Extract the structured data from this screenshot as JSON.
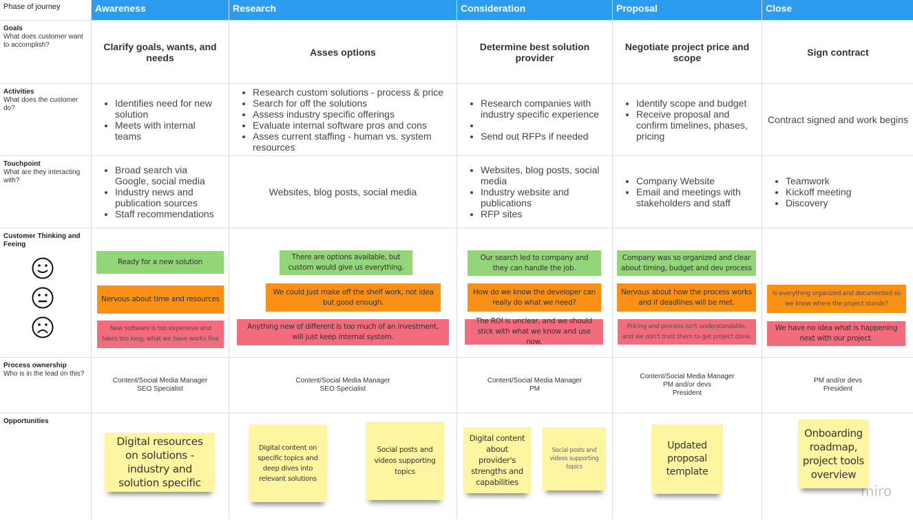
{
  "row_labels": [
    {
      "title": "Phase of journey",
      "subtitle": ""
    },
    {
      "title": "Goals",
      "subtitle": "What does customer want to accomplish?"
    },
    {
      "title": "Activities",
      "subtitle": "What does the customer do?"
    },
    {
      "title": "Touchpoint",
      "subtitle": "What are they interacting with?"
    },
    {
      "title": "Customer Thinking and Feeing",
      "subtitle": ""
    },
    {
      "title": "Process ownership",
      "subtitle": "Who is in the lead on this?"
    },
    {
      "title": "Opportunities",
      "subtitle": ""
    }
  ],
  "phases": [
    "Awareness",
    "Research",
    "Consideration",
    "Proposal",
    "Close"
  ],
  "goals": [
    "Clarify goals, wants, and needs",
    "Asses options",
    "Determine best solution provider",
    "Negotiate project price and scope",
    "Sign contract"
  ],
  "activities": [
    {
      "bullets": [
        "Identifies need for new solution",
        "Meets with internal teams"
      ]
    },
    {
      "bullets": [
        "Research custom solutions - process & price",
        "Search for off the solutions",
        "Assess industry specific offerings",
        "Evaluate internal software pros and cons",
        "Asses current staffing - human vs. system resources"
      ]
    },
    {
      "bullets": [
        "Research companies with industry specific experience",
        "",
        "Send out RFPs if needed"
      ]
    },
    {
      "bullets": [
        "Identify scope and budget",
        "Receive proposal and confirm timelines, phases, pricing"
      ]
    },
    {
      "text": "Contract signed and work begins"
    }
  ],
  "touchpoints": [
    {
      "bullets": [
        "Broad search via Google, social media",
        "Industry news and publication sources",
        "Staff recommendations"
      ]
    },
    {
      "text": "Websites, blog posts, social media"
    },
    {
      "bullets": [
        "Websites, blog posts, social media",
        "Industry website and publications",
        "RFP sites"
      ]
    },
    {
      "bullets": [
        "Company Website",
        "Email and meetings with stakeholders and  staff"
      ]
    },
    {
      "bullets": [
        "Teamwork",
        "Kickoff meeting",
        "Discovery"
      ]
    }
  ],
  "feeling_icons": [
    "happy-face-icon",
    "neutral-face-icon",
    "sad-face-icon"
  ],
  "feelings": [
    {
      "positive": "Ready for a new solution",
      "neutral": "Nervous about time and resources",
      "negative": "New software is too expensive and takes too long, what we have works fine"
    },
    {
      "positive": "There are options available, but custom would give us everything.",
      "neutral": "We could just make off the shelf work, not idea but good enough.",
      "negative": "Anything new of different is too much of an investment, will just keep internal system."
    },
    {
      "positive": "Our search led to company and they can handle the job.",
      "neutral": "How do we know the developer can really do what we need?",
      "negative": "The ROI is unclear, and we should stick with what we know and use now."
    },
    {
      "positive": "Company was so organized and clear about timing, budget and dev process",
      "neutral": "Nervous about how the process works and if deadlines will be met.",
      "negative": "Pricing and process isn't understandable, and we don't trust them to get project done."
    },
    {
      "neutral": "Is everything organized and documented so we know where the project stands?",
      "negative": "We have no idea what is happening next with our project."
    }
  ],
  "process_ownership": [
    [
      "Content/Social Media Manager",
      "SEO Specialist"
    ],
    [
      "Content/Social Media Manager",
      "SEO Specialist"
    ],
    [
      "Content/Social Media Manager",
      "PM"
    ],
    [
      "Content/Social Media Manager",
      "PM and/or devs",
      "President"
    ],
    [
      "PM and/or devs",
      "President"
    ]
  ],
  "opportunities": [
    [
      "Digital resources on solutions - industry and solution specific"
    ],
    [
      "Digital content on specific topics and deep dives into relevant solutions",
      "Social posts and videos supporting topics"
    ],
    [
      "Digital content about provider's strengths and capabilities",
      "Social posts and videos supporting topics"
    ],
    [
      "Updated proposal template"
    ],
    [
      "Onboarding roadmap, project tools overview"
    ]
  ],
  "colors": {
    "header": "#2c9cf0",
    "positive": "#93d67a",
    "neutral": "#fa9116",
    "negative": "#f26c7e",
    "sticky": "#fdf59f"
  },
  "brand": "miro"
}
